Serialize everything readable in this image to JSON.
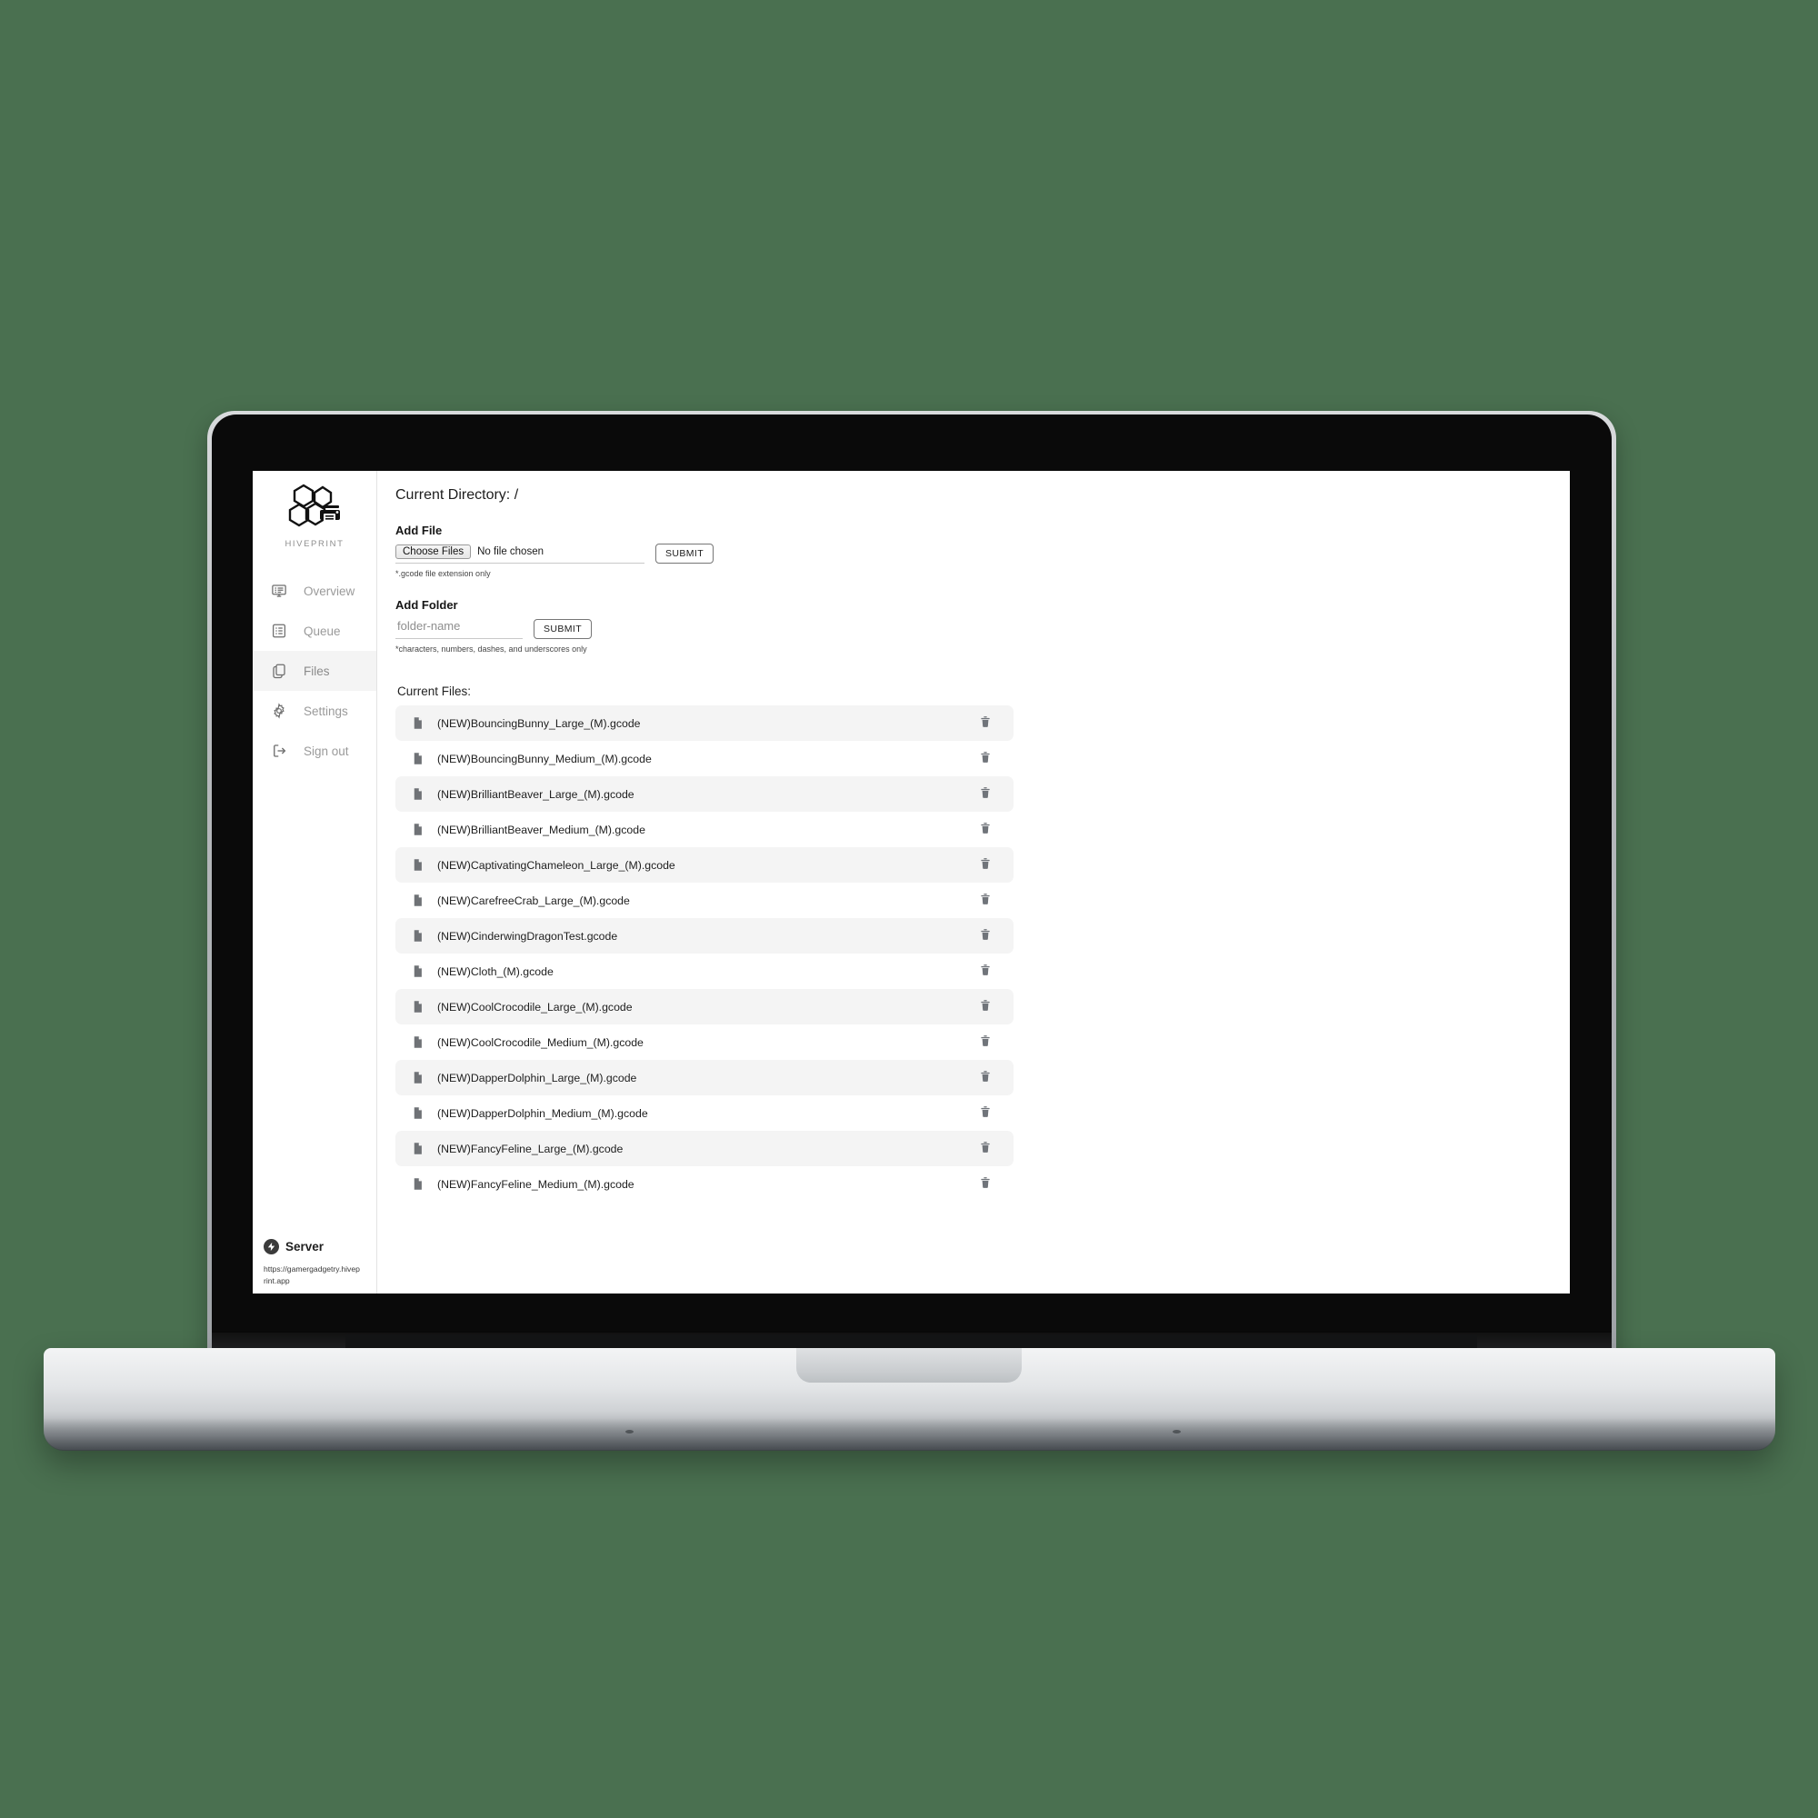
{
  "theme": {
    "background": "#4a7050",
    "surface": "#ffffff",
    "row_alt": "#f4f4f4",
    "sidebar_active": "#f4f4f4",
    "text_primary": "#1e1e1e",
    "text_muted": "#9a9a9a",
    "icon": "#6f7276",
    "border": "#e3e3e3"
  },
  "sidebar": {
    "brand": {
      "name": "HIVEPRINT",
      "logo_icon": "hive-printer-logo-icon"
    },
    "items": [
      {
        "label": "Overview",
        "icon": "overview-monitor-icon",
        "active": false
      },
      {
        "label": "Queue",
        "icon": "queue-list-icon",
        "active": false
      },
      {
        "label": "Files",
        "icon": "files-copy-icon",
        "active": true
      },
      {
        "label": "Settings",
        "icon": "gear-icon",
        "active": false
      },
      {
        "label": "Sign out",
        "icon": "sign-out-icon",
        "active": false
      }
    ],
    "server": {
      "icon": "server-bolt-icon",
      "title": "Server",
      "url": "https://gamergadgetry.hiveprint.app"
    }
  },
  "main": {
    "directory_label": "Current Directory: /",
    "add_file": {
      "heading": "Add File",
      "choose_button": "Choose Files",
      "no_file_text": "No file chosen",
      "submit_button": "SUBMIT",
      "hint": "*.gcode file extension only"
    },
    "add_folder": {
      "heading": "Add Folder",
      "placeholder": "folder-name",
      "value": "",
      "submit_button": "SUBMIT",
      "hint": "*characters, numbers, dashes, and underscores only"
    },
    "files_heading": "Current Files:",
    "files": [
      {
        "name": "(NEW)BouncingBunny_Large_(M).gcode"
      },
      {
        "name": "(NEW)BouncingBunny_Medium_(M).gcode"
      },
      {
        "name": "(NEW)BrilliantBeaver_Large_(M).gcode"
      },
      {
        "name": "(NEW)BrilliantBeaver_Medium_(M).gcode"
      },
      {
        "name": "(NEW)CaptivatingChameleon_Large_(M).gcode"
      },
      {
        "name": "(NEW)CarefreeCrab_Large_(M).gcode"
      },
      {
        "name": "(NEW)CinderwingDragonTest.gcode"
      },
      {
        "name": "(NEW)Cloth_(M).gcode"
      },
      {
        "name": "(NEW)CoolCrocodile_Large_(M).gcode"
      },
      {
        "name": "(NEW)CoolCrocodile_Medium_(M).gcode"
      },
      {
        "name": "(NEW)DapperDolphin_Large_(M).gcode"
      },
      {
        "name": "(NEW)DapperDolphin_Medium_(M).gcode"
      },
      {
        "name": "(NEW)FancyFeline_Large_(M).gcode"
      },
      {
        "name": "(NEW)FancyFeline_Medium_(M).gcode"
      }
    ],
    "delete_icon": "trash-icon",
    "file_icon": "document-icon"
  }
}
